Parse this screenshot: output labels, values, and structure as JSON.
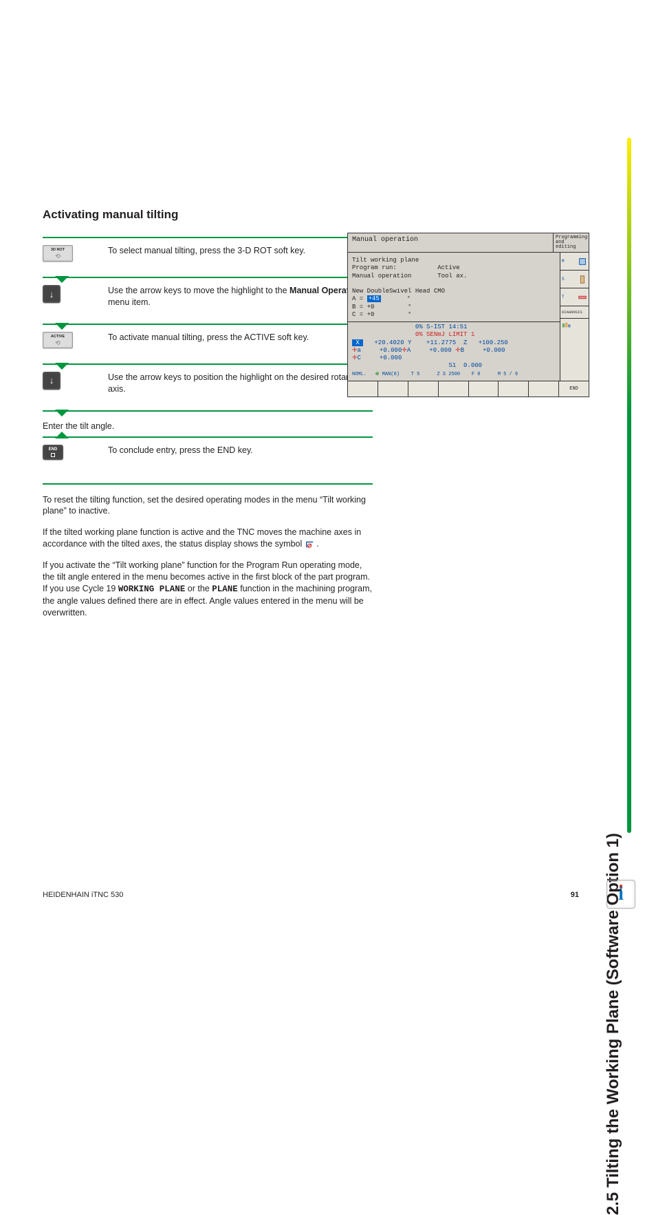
{
  "heading": "Activating manual tilting",
  "side_tab": "2.5 Tilting the Working Plane (Software Option 1)",
  "steps": [
    {
      "key_type": "softkey",
      "key_label": "3D ROT",
      "text": "To select manual tilting, press the 3-D ROT soft key."
    },
    {
      "key_type": "arrow",
      "text_pre": "Use the arrow keys to move the highlight to the ",
      "bold": "Manual Operation",
      "text_post": " menu item."
    },
    {
      "key_type": "softkey",
      "key_label": "ACTIVE",
      "text": "To activate manual tilting, press the ACTIVE soft key."
    },
    {
      "key_type": "arrow",
      "text": "Use the arrow keys to position the highlight on the desired rotary axis."
    }
  ],
  "mid_line": "Enter the tilt angle.",
  "end_step": {
    "key_label": "END",
    "text": "To conclude entry, press the END key."
  },
  "paras": [
    "To reset the tilting function, set the desired operating modes in the menu “Tilt working plane” to inactive.",
    "If the tilted working plane function is active and the TNC moves the machine axes in accordance with the tilted axes, the status display shows the symbol ",
    "If you activate the “Tilt working plane” function for the Program Run operating mode, the tilt angle entered in the menu becomes active in the first block of the part program. If you use Cycle 19 ",
    " or the ",
    " function in the machining program, the angle values defined there are in effect. Angle values entered in the menu will be overwritten."
  ],
  "mono": {
    "wp": "WORKING PLANE",
    "pl": "PLANE"
  },
  "screenshot": {
    "title": "Manual operation",
    "mini_mode": "Programming and editing",
    "lines": [
      "Tilt working plane",
      "Program run:           Active",
      "Manual operation       Tool ax.",
      "",
      "New DoubleSwivel Head CMO",
      {
        "pre": "A = ",
        "hl": "+45",
        "post": "       °"
      },
      "B = +0         °",
      "C = +0         °"
    ],
    "status1": "0% S-IST 14:51",
    "status2": "0% SENmJ LIMIT 1",
    "coords": {
      "X": "+20.4020",
      "Y": "+11.2775",
      "Z": "+100.250",
      "a": "+0.000",
      "A": "+0.000",
      "B": "+0.000",
      "C": "+0.000",
      "S1": "0.000",
      "bar_left": "NOML.",
      "bar_man": "MAN(0)",
      "bar_t": "T 5",
      "bar_zs": "Z S 2500",
      "bar_f": "F 0",
      "bar_m": "M 5 / 9"
    },
    "right_panes": [
      "M",
      "S",
      "T",
      "DIAGNOSIS"
    ],
    "soft_end": "END"
  },
  "footer": {
    "left": "HEIDENHAIN iTNC 530",
    "page": "91"
  }
}
